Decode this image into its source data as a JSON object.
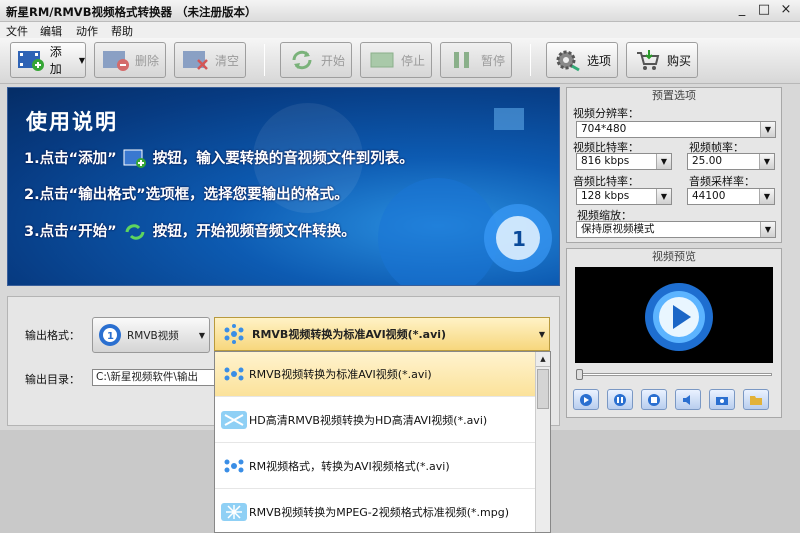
{
  "window": {
    "title": "新星RM/RMVB视频格式转换器 （未注册版本）",
    "controls": [
      "_",
      "□",
      "×"
    ]
  },
  "menu": [
    "文件",
    "编辑",
    "动作",
    "帮助"
  ],
  "toolbar": {
    "add": "添加",
    "delete": "删除",
    "clear": "清空",
    "start": "开始",
    "stop": "停止",
    "pause": "暂停",
    "options": "选项",
    "buy": "购买"
  },
  "banner": {
    "title": "使用说明",
    "steps": [
      "1.点击“添加”",
      "按钮，输入要转换的音视频文件到列表。",
      "2.点击“输出格式”选项框，选择您要输出的格式。",
      "3.点击“开始”",
      "按钮，开始视频音频文件转换。"
    ]
  },
  "settings": {
    "title": "预置选项",
    "resolution_label": "视频分辨率：",
    "resolution": "704*480",
    "vbitrate_label": "视频比特率：",
    "vbitrate": "816 kbps",
    "fps_label": "视频帧率：",
    "fps": "25.00",
    "abitrate_label": "音频比特率：",
    "abitrate": "128 kbps",
    "samplerate_label": "音频采样率：",
    "samplerate": "44100",
    "scale_label": "视频缩放：",
    "scale": "保持原视频模式"
  },
  "preview": {
    "title": "视频预览"
  },
  "output": {
    "format_label": "输出格式：",
    "format_type": "RMVB视频",
    "format_selected": "RMVB视频转换为标准AVI视频(*.avi)",
    "dir_label": "输出目录：",
    "dir_value": "C:\\新星视频软件\\输出"
  },
  "format_options": [
    "RMVB视频转换为标准AVI视频(*.avi)",
    "HD高清RMVB视频转换为HD高清AVI视频(*.avi)",
    "RM视频格式，转换为AVI视频格式(*.avi)",
    "RMVB视频转换为MPEG-2视频格式标准视频(*.mpg)"
  ],
  "colors": {
    "banner": "#0d5bb2",
    "highlight": "#fbe29a"
  }
}
